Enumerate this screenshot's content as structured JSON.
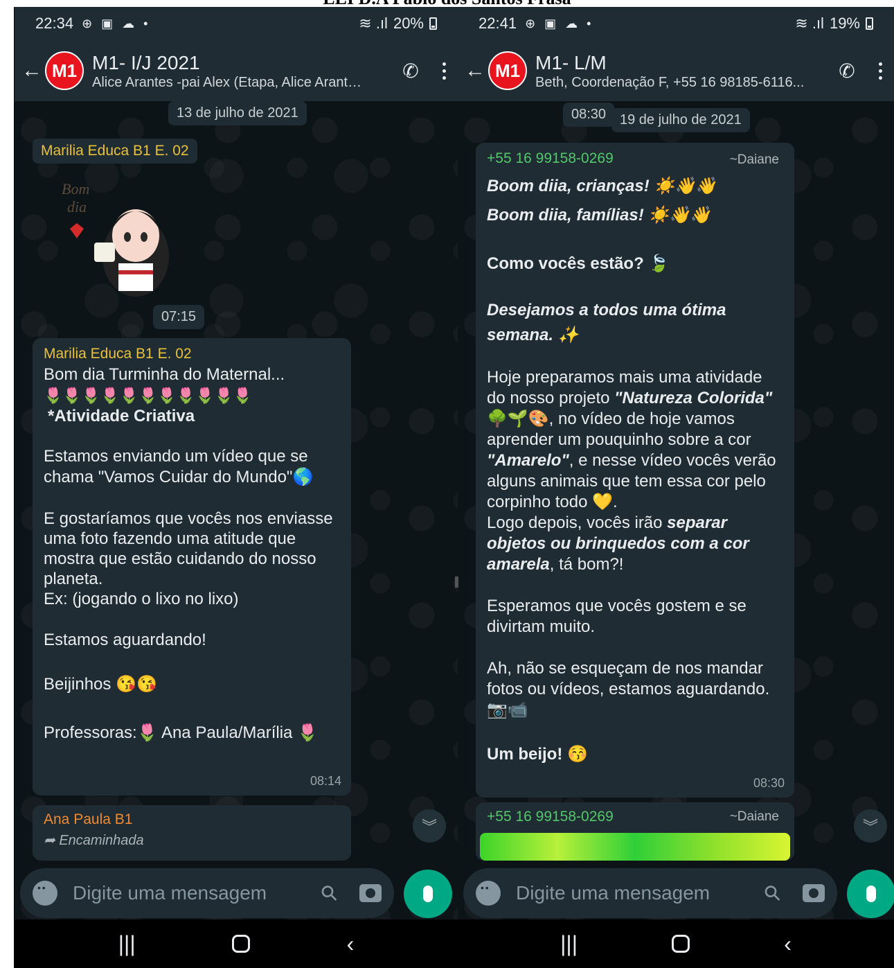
{
  "document_title": "EEI D.A Pablo dos Santos Frasa",
  "left": {
    "status": {
      "time": "22:34",
      "icons": "⊕ ▣ ☁ •",
      "battery": "20%"
    },
    "header": {
      "avatar": "M1",
      "title": "M1- I/J 2021",
      "subtitle": "Alice Arantes -pai Alex (Etapa, Alice Arantes...)"
    },
    "date_chip": "13 de julho de 2021",
    "sticker_msg": {
      "sender": "Marilia Educa B1 E. 02",
      "sticker_text": "Bom dia",
      "time": "07:15"
    },
    "msg1": {
      "sender": "Marilia Educa B1 E. 02",
      "line1": "Bom dia Turminha do Maternal...",
      "tulips": "🌷🌷🌷🌷🌷🌷🌷🌷🌷🌷🌷",
      "heading": "*Atividade Criativa",
      "p1": "Estamos enviando um vídeo que se chama \"Vamos Cuidar do Mundo\"🌎",
      "p2": "E gostaríamos que vocês nos enviasse uma foto  fazendo uma atitude que mostra que estão cuidando do nosso planeta.\nEx: (jogando o lixo no lixo)",
      "p3": "Estamos aguardando!",
      "p4": "Beijinhos 😘😘",
      "p5": "Professoras:🌷 Ana Paula/Marília 🌷",
      "time": "08:14"
    },
    "msg2": {
      "sender": "Ana Paula B1",
      "forwarded": "Encaminhada"
    },
    "composer_placeholder": "Digite uma mensagem"
  },
  "right": {
    "status": {
      "time": "22:41",
      "icons": "⊕ ▣ ☁ •",
      "battery": "19%"
    },
    "header": {
      "avatar": "M1",
      "title": "M1- L/M",
      "subtitle": "Beth, Coordenação F, +55 16 98185-6116..."
    },
    "time_chip": "08:30",
    "date_chip": "19 de julho de 2021",
    "msg1": {
      "sender": "+55 16 99158-0269",
      "name_tag": "~Daiane",
      "g1": "Boom diia, crianças! ☀️👋👋",
      "g2": "Boom diia, famílias! ☀️👋👋",
      "q": "Como vocês estão? 🍃",
      "wish": "Desejamos a todos uma ótima semana. ✨",
      "p1a": "Hoje preparamos mais uma atividade do nosso projeto ",
      "p1b": "\"Natureza Colorida\"",
      "p1c": " 🌳🌱🎨, no vídeo de hoje vamos aprender um pouquinho sobre a cor ",
      "p1d": "\"Amarelo\"",
      "p1e": ", e nesse vídeo vocês verão alguns animais que tem essa cor pelo corpinho todo 💛.",
      "p2a": "Logo depois, vocês irão ",
      "p2b": "separar objetos ou brinquedos com a cor amarela",
      "p2c": ", tá bom?!",
      "p3": "Esperamos que vocês gostem e se divirtam muito.",
      "p4": "Ah, não se esqueçam de nos mandar fotos ou vídeos, estamos aguardando. 📷📹",
      "p5": "Um beijo! 😚",
      "time": "08:30"
    },
    "msg2": {
      "sender": "+55 16 99158-0269",
      "name_tag": "~Daiane"
    },
    "composer_placeholder": "Digite uma mensagem"
  }
}
